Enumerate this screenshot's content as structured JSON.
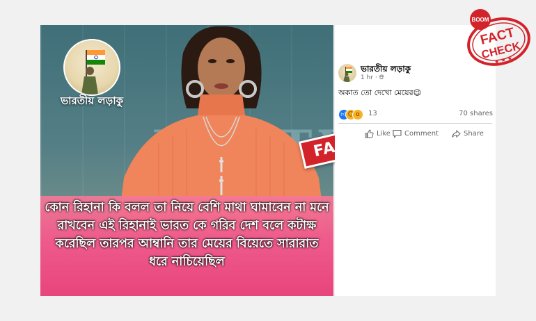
{
  "image": {
    "page_name": "ভারতীয় লড়াকু",
    "background_word": "FENTY",
    "caption": "কোন রিহানা কি বলল তা নিয়ে বেশি মাথা ঘামাবেন না মনে রাখবেন এই রিহানাই ভারত কে গরিব দেশ বলে কটাক্ষ করেছিল তারপর আম্বানি তার মেয়ের বিয়েতে সারারাত ধরে নাচিয়েছিল",
    "stamp": "FAKE"
  },
  "post": {
    "author": "ভারতীয় লড়াকু",
    "time": "1 hr",
    "text": "অকাত তো দেখো মেয়ের😉",
    "reactions_count": "13",
    "shares": "70 shares",
    "actions": {
      "like": "Like",
      "comment": "Comment",
      "share": "Share"
    }
  },
  "badge": {
    "brand": "BOOM",
    "line1": "FACT",
    "line2": "CHECK"
  },
  "colors": {
    "stamp_red": "#d2232a",
    "caption_pink": "#ee5a8b",
    "facebook_blue": "#1877f2"
  }
}
